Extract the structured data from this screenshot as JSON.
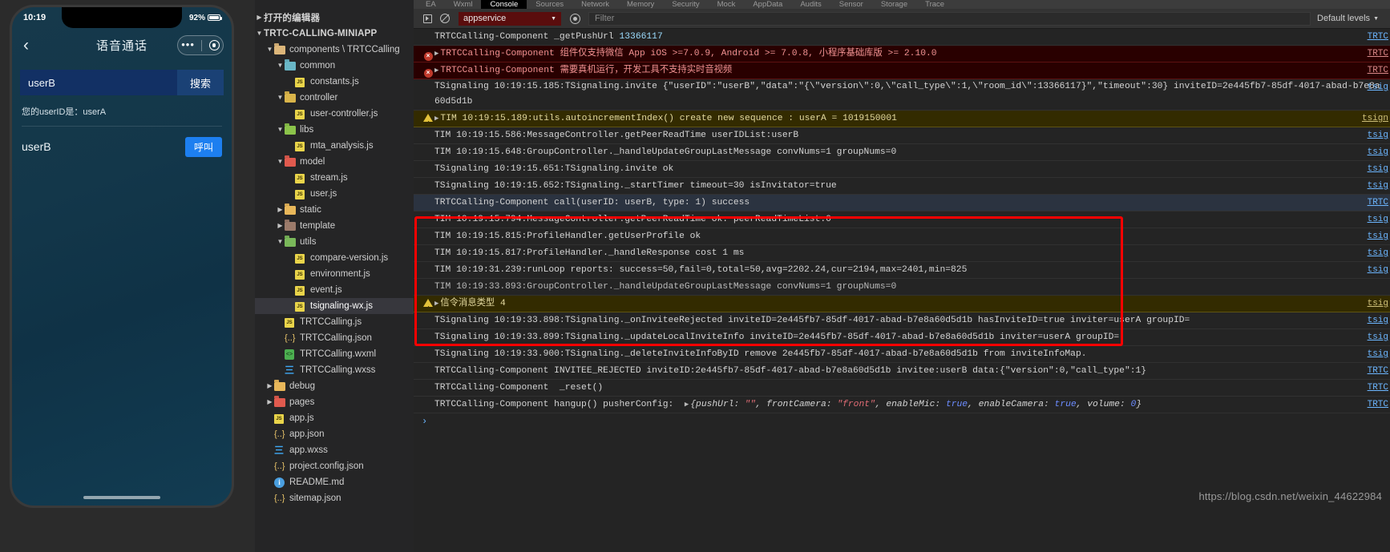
{
  "simulator": {
    "status": {
      "time": "10:19",
      "battery": "92%"
    },
    "nav": {
      "back_icon": "chevron-left",
      "title": "语音通话"
    },
    "search": {
      "value": "userB",
      "button_label": "搜索"
    },
    "hint": "您的userID是：userA",
    "user_row": {
      "name": "userB",
      "call_label": "呼叫"
    }
  },
  "explorer": {
    "open_editors": "打开的编辑器",
    "root": "TRTC-CALLING-MINIAPP",
    "items": [
      {
        "label": "components \\ TRTCCalling",
        "type": "folder",
        "color": "#dcb67a",
        "depth": 1,
        "open": true
      },
      {
        "label": "common",
        "type": "folder",
        "color": "#6ab7c7",
        "depth": 2,
        "open": true
      },
      {
        "label": "constants.js",
        "type": "js",
        "depth": 3
      },
      {
        "label": "controller",
        "type": "folder",
        "color": "#d9b44a",
        "depth": 2,
        "open": true
      },
      {
        "label": "user-controller.js",
        "type": "js",
        "depth": 3
      },
      {
        "label": "libs",
        "type": "folder",
        "color": "#8bc34a",
        "depth": 2,
        "open": true
      },
      {
        "label": "mta_analysis.js",
        "type": "js",
        "depth": 3
      },
      {
        "label": "model",
        "type": "folder",
        "color": "#e05a4e",
        "depth": 2,
        "open": true
      },
      {
        "label": "stream.js",
        "type": "js",
        "depth": 3
      },
      {
        "label": "user.js",
        "type": "js",
        "depth": 3
      },
      {
        "label": "static",
        "type": "folder",
        "color": "#e8b75a",
        "depth": 2,
        "open": false
      },
      {
        "label": "template",
        "type": "folder",
        "color": "#9c7b6b",
        "depth": 2,
        "open": false
      },
      {
        "label": "utils",
        "type": "folder",
        "color": "#7ab85a",
        "depth": 2,
        "open": true
      },
      {
        "label": "compare-version.js",
        "type": "js",
        "depth": 3
      },
      {
        "label": "environment.js",
        "type": "js",
        "depth": 3
      },
      {
        "label": "event.js",
        "type": "js",
        "depth": 3
      },
      {
        "label": "tsignaling-wx.js",
        "type": "js",
        "depth": 3,
        "selected": true
      },
      {
        "label": "TRTCCalling.js",
        "type": "js",
        "depth": 2
      },
      {
        "label": "TRTCCalling.json",
        "type": "json",
        "depth": 2
      },
      {
        "label": "TRTCCalling.wxml",
        "type": "wxml",
        "depth": 2
      },
      {
        "label": "TRTCCalling.wxss",
        "type": "wxss",
        "depth": 2
      },
      {
        "label": "debug",
        "type": "folder",
        "color": "#e8b75a",
        "depth": 1,
        "open": false
      },
      {
        "label": "pages",
        "type": "folder",
        "color": "#e05a4e",
        "depth": 1,
        "open": false
      },
      {
        "label": "app.js",
        "type": "js",
        "depth": 1
      },
      {
        "label": "app.json",
        "type": "json",
        "depth": 1
      },
      {
        "label": "app.wxss",
        "type": "wxss",
        "depth": 1
      },
      {
        "label": "project.config.json",
        "type": "json",
        "depth": 1
      },
      {
        "label": "README.md",
        "type": "md",
        "depth": 1
      },
      {
        "label": "sitemap.json",
        "type": "json",
        "depth": 1
      }
    ]
  },
  "devtools": {
    "tabs": [
      {
        "label": "EA",
        "active": false
      },
      {
        "label": "Wxml",
        "active": false
      },
      {
        "label": "Console",
        "active": true
      },
      {
        "label": "Sources",
        "active": false
      },
      {
        "label": "Network",
        "active": false
      },
      {
        "label": "Memory",
        "active": false
      },
      {
        "label": "Security",
        "active": false
      },
      {
        "label": "Mock",
        "active": false
      },
      {
        "label": "AppData",
        "active": false
      },
      {
        "label": "Audits",
        "active": false
      },
      {
        "label": "Sensor",
        "active": false
      },
      {
        "label": "Storage",
        "active": false
      },
      {
        "label": "Trace",
        "active": false
      }
    ],
    "toolbar": {
      "context_value": "appservice",
      "filter_placeholder": "Filter",
      "levels_label": "Default levels"
    },
    "logs": [
      {
        "level": "info",
        "msg": "TRTCCalling-Component _getPushUrl ",
        "extra_num": "13366117",
        "source": "TRTC"
      },
      {
        "level": "error",
        "expandable": true,
        "msg": "TRTCCalling-Component 组件仅支持微信 App iOS >=7.0.9, Android >= 7.0.8, 小程序基础库版 >= 2.10.0",
        "source": "TRTC"
      },
      {
        "level": "error",
        "expandable": true,
        "msg": "TRTCCalling-Component 需要真机运行，开发工具不支持实时音视频",
        "source": "TRTC"
      },
      {
        "level": "info",
        "wrap": true,
        "msg": "TSignaling 10:19:15.185:TSignaling.invite {\"userID\":\"userB\",\"data\":\"{\\\"version\\\":0,\\\"call_type\\\":1,\\\"room_id\\\":13366117}\",\"timeout\":30} inviteID=2e445fb7-85df-4017-abad-b7e8a60d5d1b",
        "source": "tsig"
      },
      {
        "level": "warn",
        "expandable": true,
        "msg": "TIM 10:19:15.189:utils.autoincrementIndex() create new sequence : userA = 1019150001",
        "source": "tsign"
      },
      {
        "level": "info",
        "msg": "TIM 10:19:15.586:MessageController.getPeerReadTime userIDList:userB",
        "source": "tsig"
      },
      {
        "level": "info",
        "msg": "TIM 10:19:15.648:GroupController._handleUpdateGroupLastMessage convNums=1 groupNums=0",
        "source": "tsig"
      },
      {
        "level": "info",
        "msg": "TSignaling 10:19:15.651:TSignaling.invite ok",
        "source": "tsig"
      },
      {
        "level": "info",
        "msg": "TSignaling 10:19:15.652:TSignaling._startTimer timeout=30 isInvitator=true",
        "source": "tsig"
      },
      {
        "level": "highlight",
        "msg": "TRTCCalling-Component call(userID: userB, type: 1) success",
        "source": "TRTC"
      },
      {
        "level": "info",
        "msg": "TIM 10:19:15.794:MessageController.getPeerReadTime ok. peerReadTimeList:0",
        "source": "tsig"
      },
      {
        "level": "info",
        "msg": "TIM 10:19:15.815:ProfileHandler.getUserProfile ok",
        "source": "tsig"
      },
      {
        "level": "info",
        "msg": "TIM 10:19:15.817:ProfileHandler._handleResponse cost 1 ms",
        "source": "tsig"
      },
      {
        "level": "info",
        "msg": "TIM 10:19:31.239:runLoop reports: success=50,fail=0,total=50,avg=2202.24,cur=2194,max=2401,min=825",
        "source": "tsig"
      },
      {
        "level": "info",
        "dim": true,
        "msg": "TIM 10:19:33.893:GroupController._handleUpdateGroupLastMessage convNums=1 groupNums=0",
        "source": ""
      },
      {
        "level": "warn",
        "expandable": true,
        "msg": "信令消息类型 4",
        "source": "tsig"
      },
      {
        "level": "info",
        "msg": "TSignaling 10:19:33.898:TSignaling._onInviteeRejected inviteID=2e445fb7-85df-4017-abad-b7e8a60d5d1b hasInviteID=true inviter=userA groupID=",
        "source": "tsig"
      },
      {
        "level": "info",
        "msg": "TSignaling 10:19:33.899:TSignaling._updateLocalInviteInfo inviteID=2e445fb7-85df-4017-abad-b7e8a60d5d1b inviter=userA groupID=",
        "source": "tsig"
      },
      {
        "level": "info",
        "msg": "TSignaling 10:19:33.900:TSignaling._deleteInviteInfoByID remove 2e445fb7-85df-4017-abad-b7e8a60d5d1b from inviteInfoMap.",
        "source": "tsig"
      },
      {
        "level": "info",
        "msg": "TRTCCalling-Component INVITEE_REJECTED inviteID:2e445fb7-85df-4017-abad-b7e8a60d5d1b invitee:userB data:{\"version\":0,\"call_type\":1}",
        "source": "TRTC"
      },
      {
        "level": "info",
        "msg": "TRTCCalling-Component  _reset()",
        "source": "TRTC"
      },
      {
        "level": "object",
        "msg_prefix": "TRTCCalling-Component hangup() pusherConfig:  ",
        "obj_parts": [
          {
            "text": "{pushUrl: ",
            "style": "ital"
          },
          {
            "text": "\"\"",
            "style": "str"
          },
          {
            "text": ", frontCamera: ",
            "style": "ital"
          },
          {
            "text": "\"front\"",
            "style": "str"
          },
          {
            "text": ", enableMic: ",
            "style": "ital"
          },
          {
            "text": "true",
            "style": "bool"
          },
          {
            "text": ", enableCamera: ",
            "style": "ital"
          },
          {
            "text": "true",
            "style": "bool"
          },
          {
            "text": ", volume: ",
            "style": "ital"
          },
          {
            "text": "0",
            "style": "bool"
          },
          {
            "text": "}",
            "style": "ital"
          }
        ],
        "source": "TRTC"
      }
    ],
    "prompt_symbol": "›"
  },
  "watermark": "https://blog.csdn.net/weixin_44622984"
}
